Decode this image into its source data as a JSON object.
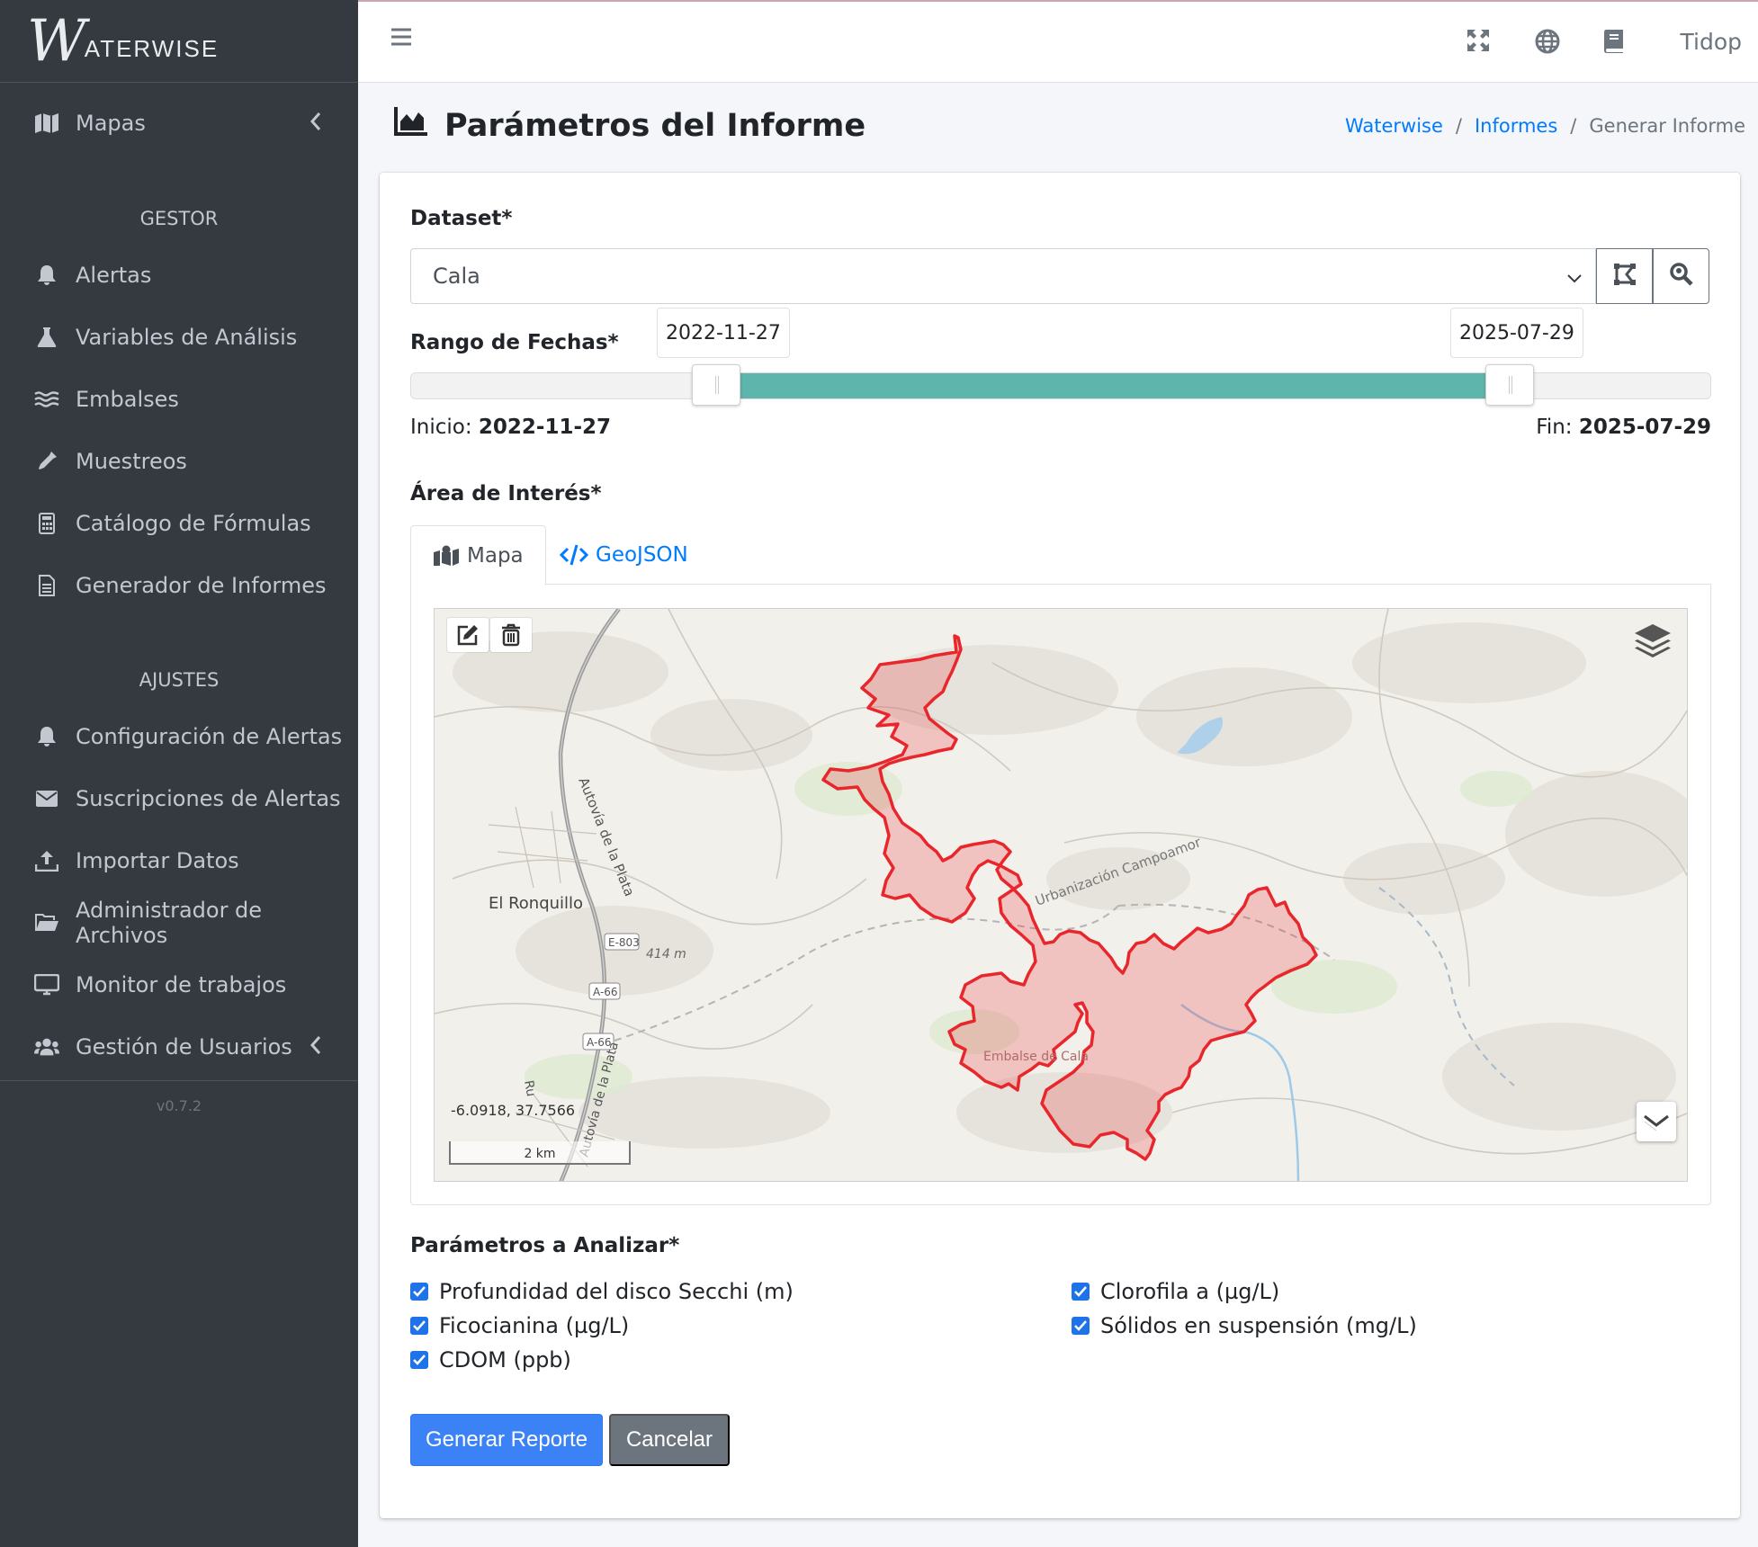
{
  "brand": {
    "mark": "W",
    "text": "ATERWISE"
  },
  "sidebar": {
    "top_item": {
      "label": "Mapas",
      "icon": "map-icon"
    },
    "sections": [
      {
        "header": "GESTOR",
        "items": [
          {
            "label": "Alertas",
            "icon": "bell-icon"
          },
          {
            "label": "Variables de Análisis",
            "icon": "flask-icon"
          },
          {
            "label": "Embalses",
            "icon": "water-icon"
          },
          {
            "label": "Muestreos",
            "icon": "eyedropper-icon"
          },
          {
            "label": "Catálogo de Fórmulas",
            "icon": "calculator-icon"
          },
          {
            "label": "Generador de Informes",
            "icon": "file-icon"
          }
        ]
      },
      {
        "header": "AJUSTES",
        "items": [
          {
            "label": "Configuración de Alertas",
            "icon": "bell-icon"
          },
          {
            "label": "Suscripciones de Alertas",
            "icon": "envelope-icon"
          },
          {
            "label": "Importar Datos",
            "icon": "upload-icon"
          },
          {
            "label": "Administrador de Archivos",
            "icon": "folder-open-icon"
          },
          {
            "label": "Monitor de trabajos",
            "icon": "desktop-icon"
          },
          {
            "label": "Gestión de Usuarios",
            "icon": "users-icon"
          }
        ]
      }
    ],
    "version": "v0.7.2"
  },
  "topbar": {
    "user": "Tidop"
  },
  "page": {
    "title": "Parámetros del Informe",
    "breadcrumb": [
      "Waterwise",
      "Informes",
      "Generar Informe"
    ]
  },
  "form": {
    "dataset_label": "Dataset*",
    "dataset_value": "Cala",
    "date_range_label": "Rango de Fechas*",
    "date_start": "2022-11-27",
    "date_end": "2025-07-29",
    "slider": {
      "min": "2022-11-27",
      "max": "2025-07-29",
      "start_fraction": 0.235,
      "end_fraction": 0.845
    },
    "start_prefix": "Inicio:",
    "end_prefix": "Fin:",
    "area_label": "Área de Interés*",
    "tabs": [
      "Mapa",
      "GeoJSON"
    ],
    "map": {
      "coords": "-6.0918, 37.7566",
      "scale": "2 km",
      "labels": {
        "town": "El Ronquillo",
        "road1": "Autovía de la Plata",
        "road2": "Urbanización Campoamor",
        "reservoir": "Embalse de Cala",
        "elev": "414 m",
        "e803": "E-803",
        "a66a": "A-66",
        "a66b": "A-66",
        "bottom_road": "Autovía de la Plata",
        "ru": "Ru"
      },
      "polygon_color": "#e8262b"
    },
    "params_label": "Parámetros a Analizar*",
    "params": [
      {
        "label": "Profundidad del disco Secchi (m)",
        "checked": true
      },
      {
        "label": "Clorofila a (µg/L)",
        "checked": true
      },
      {
        "label": "Ficocianina (µg/L)",
        "checked": true
      },
      {
        "label": "Sólidos en suspensión (mg/L)",
        "checked": true
      },
      {
        "label": "CDOM (ppb)",
        "checked": true
      }
    ],
    "submit": "Generar Reporte",
    "cancel": "Cancelar"
  }
}
